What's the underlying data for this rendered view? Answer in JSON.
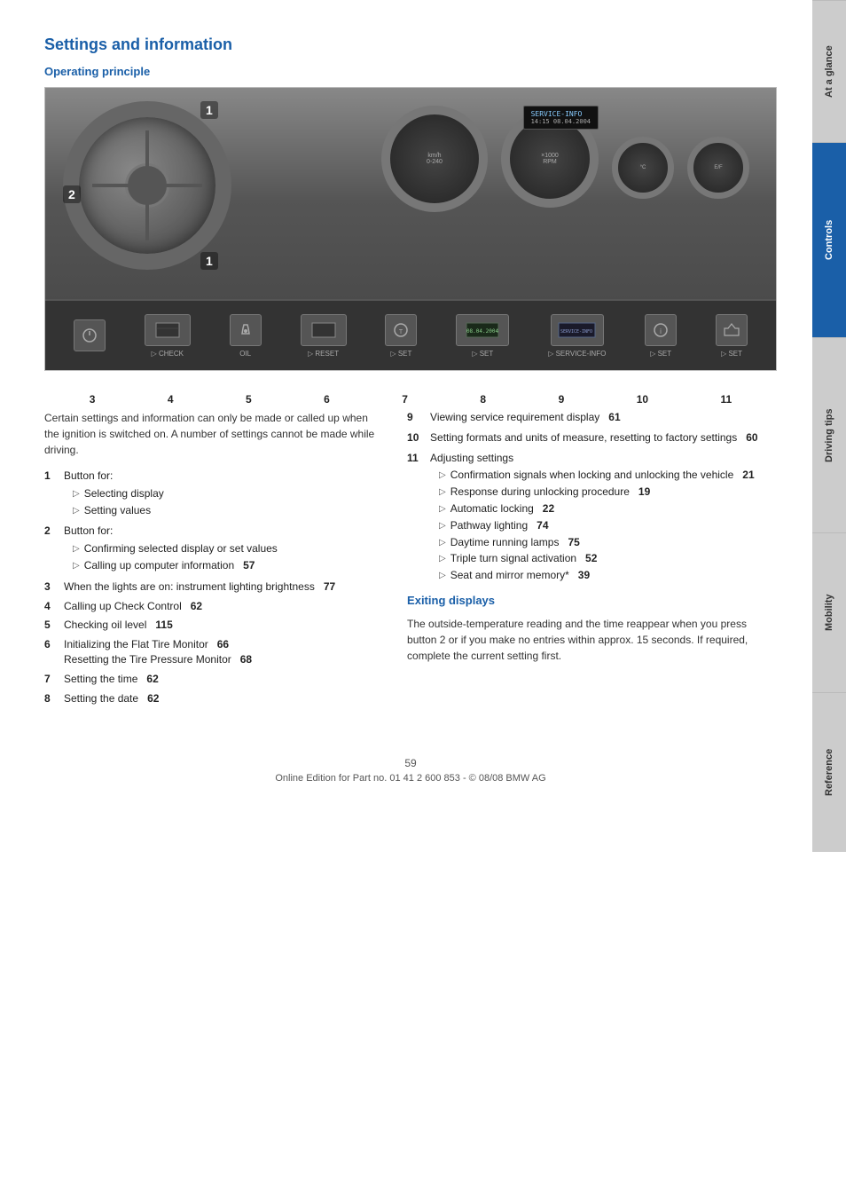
{
  "page": {
    "title": "Settings and information",
    "subtitle": "Operating principle",
    "page_number": "59",
    "footer_text": "Online Edition for Part no. 01 41 2 600 853 - © 08/08 BMW AG"
  },
  "side_tabs": [
    {
      "id": "at-glance",
      "label": "At a glance",
      "active": false
    },
    {
      "id": "controls",
      "label": "Controls",
      "active": true
    },
    {
      "id": "driving-tips",
      "label": "Driving tips",
      "active": false
    },
    {
      "id": "mobility",
      "label": "Mobility",
      "active": false
    },
    {
      "id": "reference",
      "label": "Reference",
      "active": false
    }
  ],
  "intro_text": "Certain settings and information can only be made or called up when the ignition is switched on. A number of settings cannot be made while driving.",
  "left_list": [
    {
      "num": "1",
      "text": "Button for:",
      "subitems": [
        "Selecting display",
        "Setting values"
      ]
    },
    {
      "num": "2",
      "text": "Button for:",
      "subitems": [
        "Confirming selected display or set values",
        "Calling up computer information  57"
      ]
    },
    {
      "num": "3",
      "text": "When the lights are on: instrument lighting brightness  77",
      "subitems": []
    },
    {
      "num": "4",
      "text": "Calling up Check Control  62",
      "subitems": []
    },
    {
      "num": "5",
      "text": "Checking oil level  115",
      "subitems": []
    },
    {
      "num": "6",
      "text": "Initializing the Flat Tire Monitor  66\nResetting the Tire Pressure Monitor  68",
      "subitems": []
    },
    {
      "num": "7",
      "text": "Setting the time  62",
      "subitems": []
    },
    {
      "num": "8",
      "text": "Setting the date  62",
      "subitems": []
    }
  ],
  "right_list": [
    {
      "num": "9",
      "text": "Viewing service requirement display  61",
      "subitems": []
    },
    {
      "num": "10",
      "text": "Setting formats and units of measure, resetting to factory settings  60",
      "subitems": []
    },
    {
      "num": "11",
      "text": "Adjusting settings",
      "subitems": [
        "Confirmation signals when locking and unlocking the vehicle  21",
        "Response during unlocking procedure  19",
        "Automatic locking  22",
        "Pathway lighting  74",
        "Daytime running lamps  75",
        "Triple turn signal activation  52",
        "Seat and mirror memory*  39"
      ]
    }
  ],
  "exiting_displays": {
    "title": "Exiting displays",
    "text": "The outside-temperature reading and the time reappear when you press button 2 or if you make no entries within approx. 15 seconds. If required, complete the current setting first."
  },
  "image_numbers": [
    "3",
    "4",
    "5",
    "6",
    "7",
    "8",
    "9",
    "10",
    "11"
  ],
  "callout_numbers": [
    "1",
    "2",
    "1"
  ]
}
